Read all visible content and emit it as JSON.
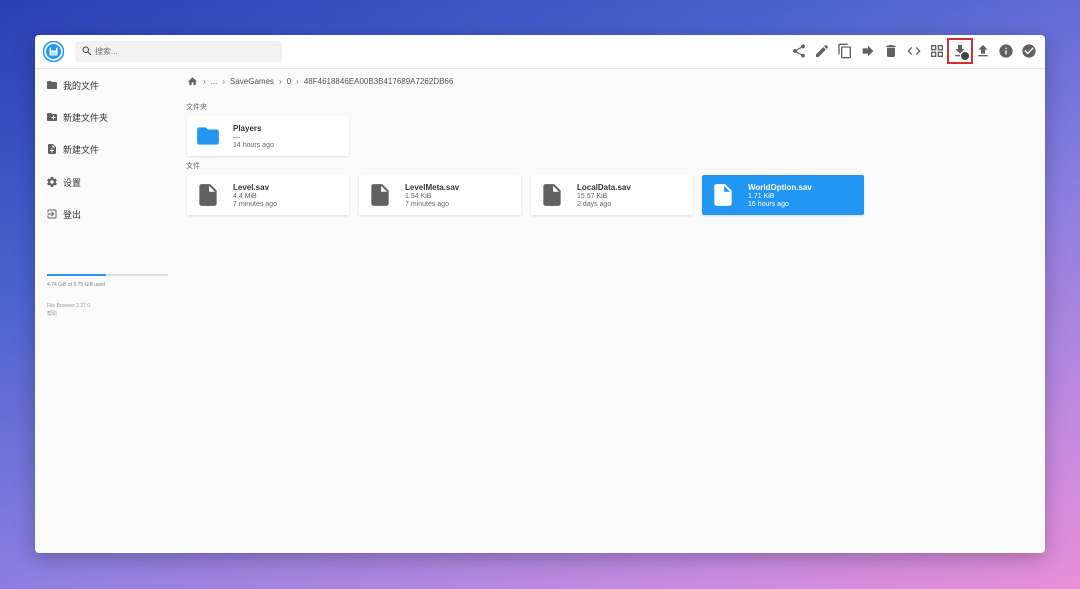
{
  "search": {
    "placeholder": "搜索..."
  },
  "toolbar": {
    "buttons": [
      {
        "name": "share-icon"
      },
      {
        "name": "edit-icon"
      },
      {
        "name": "copy-icon"
      },
      {
        "name": "move-icon"
      },
      {
        "name": "delete-icon"
      },
      {
        "name": "code-icon"
      },
      {
        "name": "grid-view-icon"
      },
      {
        "name": "download-icon",
        "highlighted": true
      },
      {
        "name": "upload-icon"
      },
      {
        "name": "info-icon"
      },
      {
        "name": "select-all-icon"
      }
    ]
  },
  "sidebar": {
    "items": [
      {
        "label": "我的文件",
        "icon": "folder-icon"
      },
      {
        "label": "新建文件夹",
        "icon": "new-folder-icon"
      },
      {
        "label": "新建文件",
        "icon": "new-file-icon"
      },
      {
        "label": "设置",
        "icon": "settings-icon"
      },
      {
        "label": "登出",
        "icon": "logout-icon"
      }
    ],
    "quota_text": "4.74 GiB of 9.75 GiB used",
    "quota_fraction": 0.49,
    "footer_line1": "File Browser 2.27.0",
    "footer_line2": "帮助"
  },
  "breadcrumb": {
    "items": [
      "...",
      "SaveGames",
      "0",
      "48F4618846EA00B3B417689A7262DB66"
    ]
  },
  "folders_title": "文件夹",
  "files_title": "文件",
  "folders": [
    {
      "name": "Players",
      "size": "—",
      "modified": "14 hours ago"
    }
  ],
  "files": [
    {
      "name": "Level.sav",
      "size": "4.4 MiB",
      "modified": "7 minutes ago"
    },
    {
      "name": "LevelMeta.sav",
      "size": "1.54 KiB",
      "modified": "7 minutes ago"
    },
    {
      "name": "LocalData.sav",
      "size": "15.57 KiB",
      "modified": "2 days ago"
    },
    {
      "name": "WorldOption.sav",
      "size": "1.71 KiB",
      "modified": "16 hours ago",
      "selected": true
    }
  ],
  "colors": {
    "accent": "#2196f3",
    "highlight": "#d32f2f",
    "icon": "#616161"
  }
}
